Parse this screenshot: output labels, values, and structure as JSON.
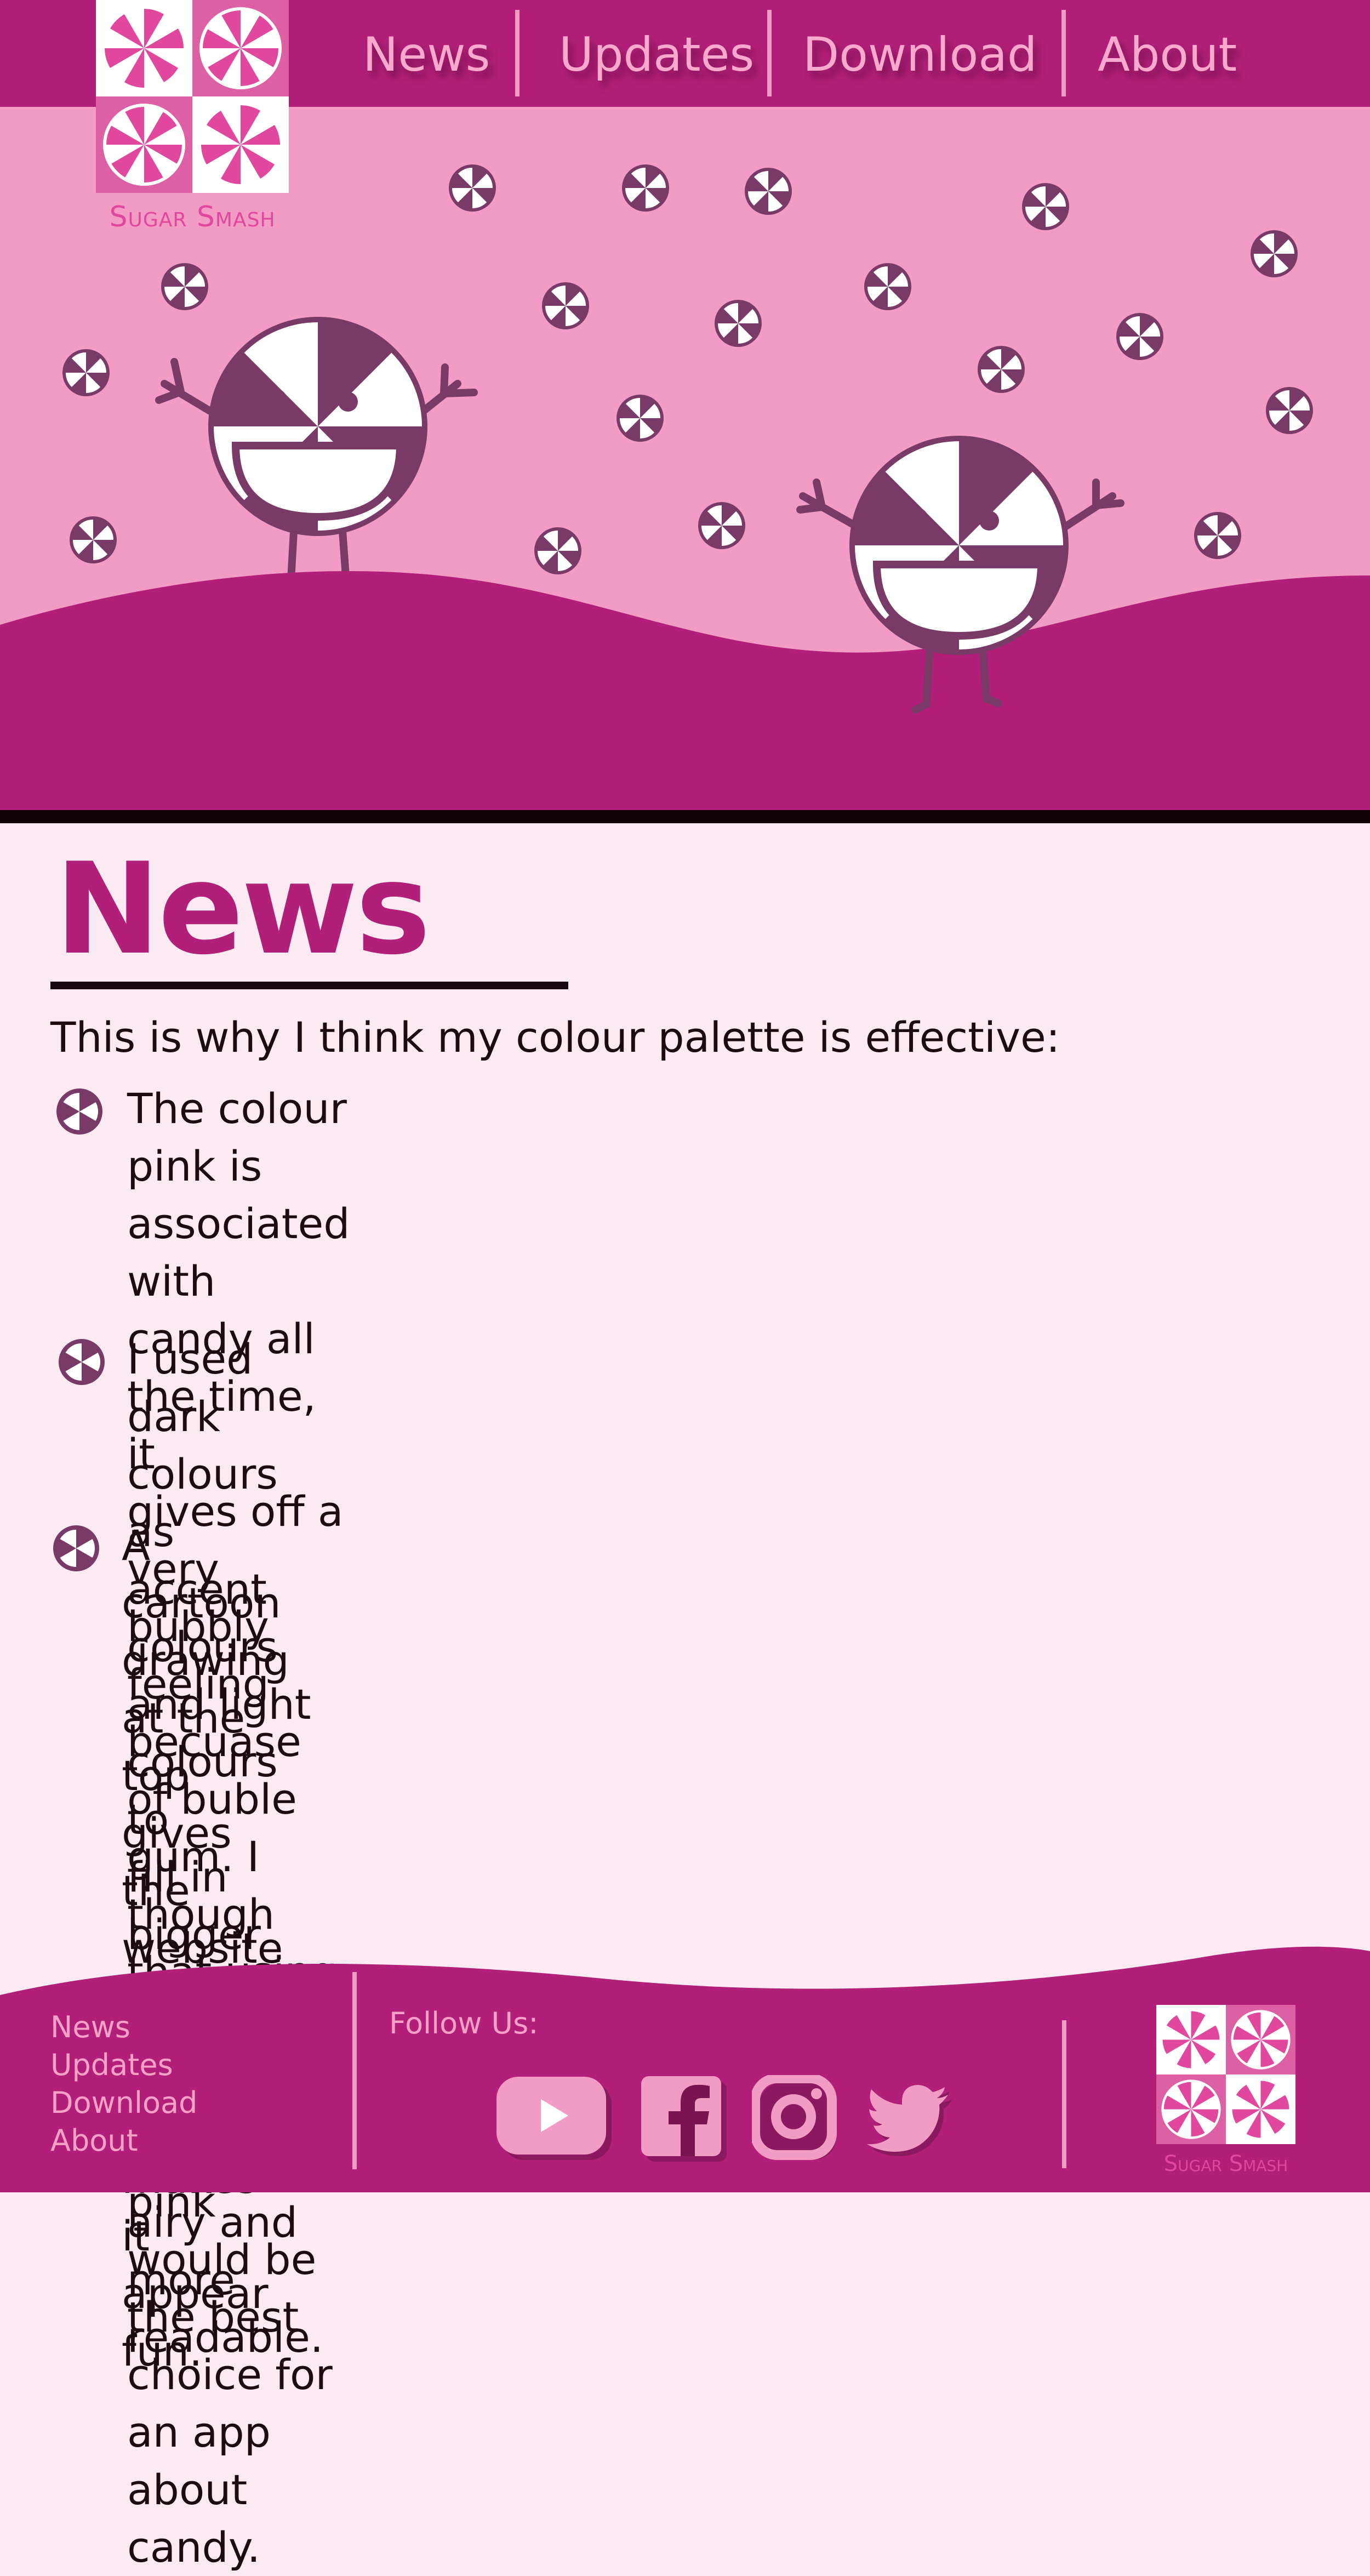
{
  "brand": {
    "name": "Sugar Smash",
    "colors": {
      "dark": "#b11f78",
      "mid": "#f29bc5",
      "light": "#fbeaf2",
      "accent": "#7a3a67",
      "logo": "#dd5fa4"
    }
  },
  "nav": {
    "items": [
      {
        "label": "News"
      },
      {
        "label": "Updates"
      },
      {
        "label": "Download"
      },
      {
        "label": "About"
      }
    ]
  },
  "hero": {
    "illustration": "two-peppermint-candy-characters"
  },
  "main": {
    "title": "News",
    "intro": "This is why I think my colour palette is effective:",
    "bullets": [
      {
        "lines": [
          "The colour pink is associated with candy all the time, it",
          "gives off a very bubbly feeling becuase of buble gum. I",
          "though that using all different shades of pink would be",
          "the best choice for an app about candy."
        ]
      },
      {
        "lines": [
          "I used dark colours as accent colours and light colours to",
          "fill in bigger spaces to keep the design airy and more",
          "readable."
        ]
      },
      {
        "lines": [
          "A cartoon drawing at the top gives the website youth-",
          "fulness and makes it appear fun."
        ]
      }
    ]
  },
  "footer": {
    "links": [
      {
        "label": "News"
      },
      {
        "label": "Updates"
      },
      {
        "label": "Download"
      },
      {
        "label": "About"
      }
    ],
    "follow_label": "Follow Us:",
    "social": [
      {
        "icon": "youtube-icon"
      },
      {
        "icon": "facebook-icon"
      },
      {
        "icon": "instagram-icon"
      },
      {
        "icon": "twitter-icon"
      }
    ]
  }
}
